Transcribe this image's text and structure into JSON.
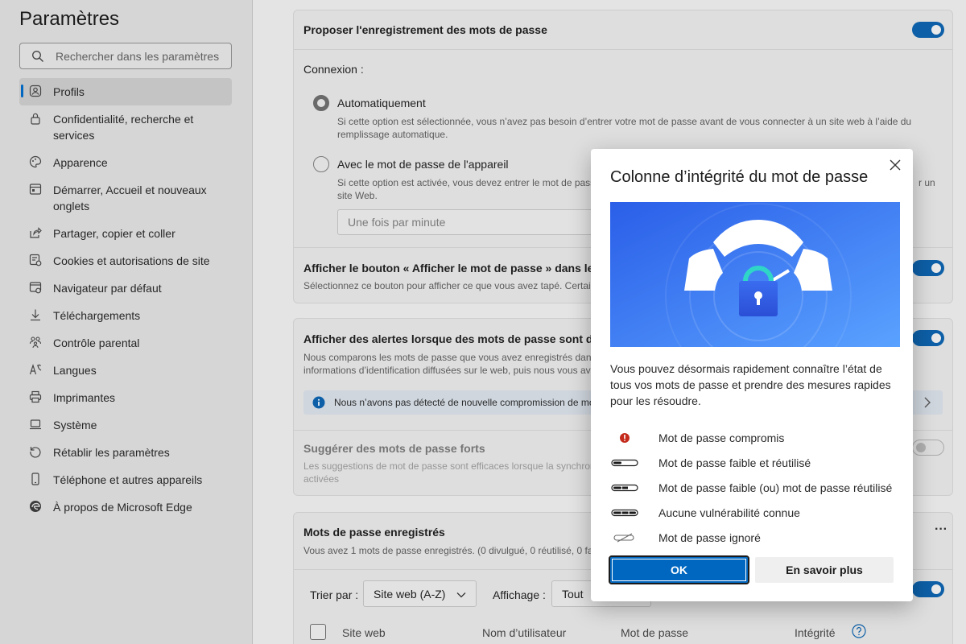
{
  "sidebar": {
    "title": "Paramètres",
    "search_placeholder": "Rechercher dans les paramètres",
    "items": [
      {
        "label": "Profils"
      },
      {
        "label": "Confidentialité, recherche et services"
      },
      {
        "label": "Apparence"
      },
      {
        "label": "Démarrer, Accueil et nouveaux onglets"
      },
      {
        "label": "Partager, copier et coller"
      },
      {
        "label": "Cookies et autorisations de site"
      },
      {
        "label": "Navigateur par défaut"
      },
      {
        "label": "Téléchargements"
      },
      {
        "label": "Contrôle parental"
      },
      {
        "label": "Langues"
      },
      {
        "label": "Imprimantes"
      },
      {
        "label": "Système"
      },
      {
        "label": "Rétablir les paramètres"
      },
      {
        "label": "Téléphone et autres appareils"
      },
      {
        "label": "À propos de Microsoft Edge"
      }
    ]
  },
  "main": {
    "offer_save": "Proposer l'enregistrement des mots de passe",
    "connexion_label": "Connexion :",
    "auto_label": "Automatiquement",
    "auto_desc": "Si cette option est sélectionnée, vous n’avez pas besoin d’entrer votre mot de passe avant de vous connecter à un site web à l’aide du remplissage automatique.",
    "device_label": "Avec le mot de passe de l'appareil",
    "device_desc_a": "Si cette option est activée, vous devez entrer le mot de pass",
    "device_desc_b": "r un",
    "device_desc_c": "site Web.",
    "frequency_value": "Une fois par minute",
    "show_button_title": "Afficher le bouton « Afficher le mot de passe » dans les c",
    "show_button_desc": "Sélectionnez ce bouton pour afficher ce que vous avez tapé. Certain",
    "alerts_title": "Afficher des alertes lorsque des mots de passe sont déte",
    "alerts_desc_1": "Nous comparons les mots de passe que vous avez enregistrés dans",
    "alerts_desc_2": "informations d’identification diffusées sur le web, puis nous vous av",
    "alerts_info": "Nous n’avons pas détecté de nouvelle compromission de mo",
    "suggest_title": "Suggérer des mots de passe forts",
    "suggest_desc_1": "Les suggestions de mot de passe sont efficaces lorsque la synchroni",
    "suggest_desc_2": "activées",
    "saved_title": "Mots de passe enregistrés",
    "saved_desc": "Vous avez 1 mots de passe enregistrés. (0 divulgué, 0 réutilisé, 0 faib",
    "sort_label": "Trier par :",
    "sort_value": "Site web (A-Z)",
    "view_label": "Affichage :",
    "view_value": "Tout",
    "col_site": "Site web",
    "col_user": "Nom d’utilisateur",
    "col_password": "Mot de passe",
    "col_health": "Intégrité",
    "more_dots": "···"
  },
  "modal": {
    "title": "Colonne d’intégrité du mot de passe",
    "description": "Vous pouvez désormais rapidement connaître l’état de tous vos mots de passe et prendre des mesures rapides pour les résoudre.",
    "legend": [
      {
        "label": "Mot de passe compromis",
        "icon": "alert-icon"
      },
      {
        "label": "Mot de passe faible et réutilisé",
        "icon": "strength-1-icon"
      },
      {
        "label": "Mot de passe faible (ou) mot de passe réutilisé",
        "icon": "strength-2-icon"
      },
      {
        "label": "Aucune vulnérabilité connue",
        "icon": "strength-3-icon"
      },
      {
        "label": "Mot de passe ignoré",
        "icon": "ignored-icon"
      }
    ],
    "ok_label": "OK",
    "learn_more_label": "En savoir plus"
  },
  "colors": {
    "accent": "#0067c0",
    "toggle_on": "#0d5fa7",
    "alert_red": "#c42b1c"
  }
}
